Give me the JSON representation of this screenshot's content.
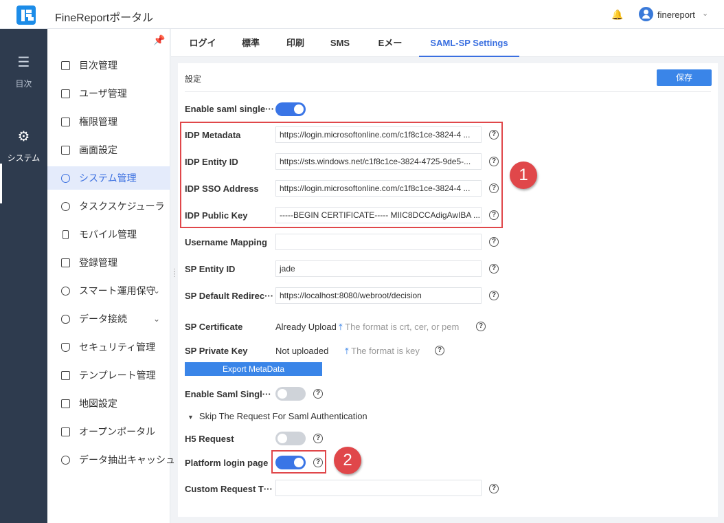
{
  "header": {
    "app_title": "FineReportポータル",
    "bell_icon": "bell-icon",
    "username": "finereport"
  },
  "rail": {
    "items": [
      {
        "label": "目次",
        "icon": "list-icon"
      },
      {
        "label": "システム",
        "icon": "gear-icon",
        "active": true
      }
    ]
  },
  "sidebar": {
    "items": [
      {
        "label": "目次管理"
      },
      {
        "label": "ユーザ管理"
      },
      {
        "label": "権限管理"
      },
      {
        "label": "画面設定"
      },
      {
        "label": "システム管理",
        "active": true
      },
      {
        "label": "タスクスケジューラ"
      },
      {
        "label": "モバイル管理"
      },
      {
        "label": "登録管理"
      },
      {
        "label": "スマート運用保守",
        "expandable": true
      },
      {
        "label": "データ接続",
        "expandable": true
      },
      {
        "label": "セキュリティ管理"
      },
      {
        "label": "テンプレート管理"
      },
      {
        "label": "地図設定"
      },
      {
        "label": "オープンポータル"
      },
      {
        "label": "データ抽出キャッシュ"
      }
    ]
  },
  "tabs": [
    {
      "label": "ログイン"
    },
    {
      "label": "標準"
    },
    {
      "label": "印刷"
    },
    {
      "label": "SMS"
    },
    {
      "label": "Eメール"
    },
    {
      "label": "SAML-SP Settings",
      "active": true
    }
  ],
  "panel": {
    "title": "設定",
    "save_label": "保存",
    "enable_sso_label": "Enable saml single···",
    "enable_sso_on": true,
    "idp_metadata_label": "IDP Metadata",
    "idp_metadata_value": "https://login.microsoftonline.com/c1f8c1ce-3824-4 ...",
    "idp_entity_label": "IDP Entity ID",
    "idp_entity_value": "https://sts.windows.net/c1f8c1ce-3824-4725-9de5-...",
    "idp_sso_label": "IDP SSO Address",
    "idp_sso_value": "https://login.microsoftonline.com/c1f8c1ce-3824-4 ...",
    "idp_key_label": "IDP Public Key",
    "idp_key_value": "-----BEGIN CERTIFICATE----- MIIC8DCCAdigAwIBA ...",
    "username_mapping_label": "Username Mapping",
    "username_mapping_value": "",
    "sp_entity_label": "SP Entity ID",
    "sp_entity_value": "jade",
    "sp_redirect_label": "SP Default Redirec···",
    "sp_redirect_value": "https://localhost:8080/webroot/decision",
    "sp_cert_label": "SP Certificate",
    "sp_cert_status": "Already Upload",
    "sp_cert_hint": "The format is crt, cer, or pem",
    "sp_key_label": "SP Private Key",
    "sp_key_status": "Not uploaded",
    "sp_key_hint": "The format is key",
    "export_label": "Export MetaData",
    "enable_slo_label": "Enable Saml Singl···",
    "enable_slo_on": false,
    "skip_section_label": "Skip The Request For Saml Authentication",
    "h5_label": "H5 Request",
    "h5_on": false,
    "platform_label": "Platform login page",
    "platform_on": true,
    "custom_label": "Custom Request T···",
    "custom_value": ""
  },
  "annotations": {
    "badge1": "1",
    "badge2": "2",
    "color": "#e0474a"
  }
}
